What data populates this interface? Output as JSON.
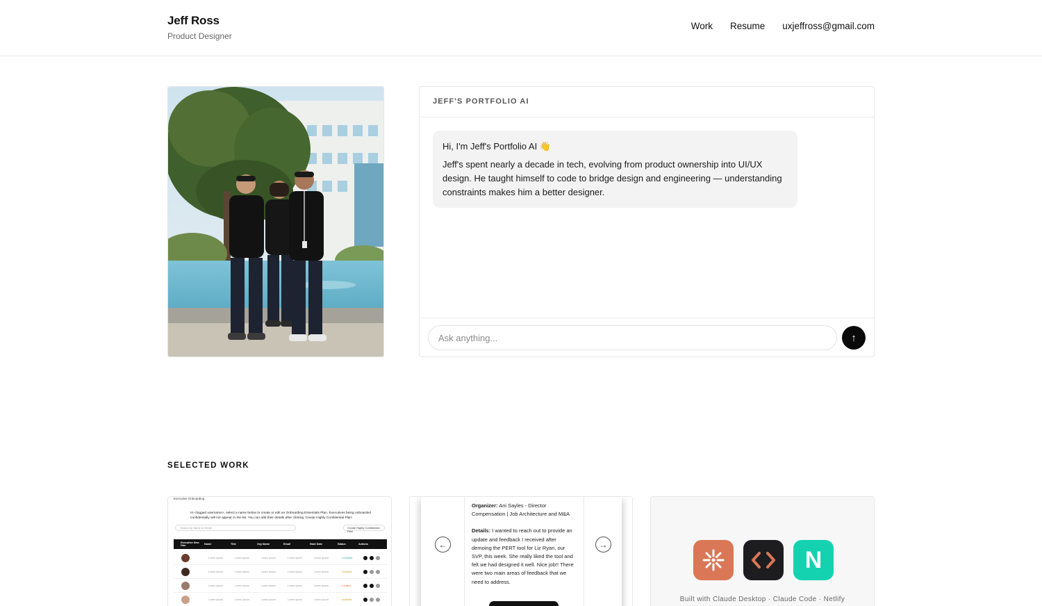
{
  "header": {
    "name": "Jeff Ross",
    "role": "Product Designer",
    "nav": [
      {
        "label": "Work"
      },
      {
        "label": "Resume"
      },
      {
        "label": "uxjeffross@gmail.com"
      }
    ]
  },
  "chat": {
    "title": "JEFF'S PORTFOLIO AI",
    "greeting": "Hi, I'm Jeff's Portfolio AI 👋",
    "message": "Jeff's spent nearly a decade in tech, evolving from product ownership into UI/UX design. He taught himself to code to bridge design and engineering — understanding constraints makes him a better designer.",
    "input_placeholder": "Ask anything...",
    "send_icon": "↑"
  },
  "work": {
    "section_title": "SELECTED WORK",
    "card1": {
      "breadcrumb": "Executive Onboarding",
      "note": "Hi <logged username>, select a name below to create or edit an Onboarding Essentials Plan. Executives being onboarded confidentially will not appear in the list. You can add their details after clicking 'Create Highly Confidential Plan'.",
      "search_placeholder": "Search by Name or Email",
      "plan_button": "Create Highly Confidential Plan",
      "columns": [
        "Executive New Hire",
        "Name",
        "Title",
        "Org Name",
        "Email",
        "Start Date",
        "Status",
        "Actions"
      ],
      "rows": [
        {
          "cells": [
            "Lorem Ipsum",
            "Lorem Ipsum",
            "Lorem Ipsum",
            "Lorem Ipsum",
            "Lorem Ipsum"
          ],
          "status": "Complete",
          "status_color": "#2bb3a3"
        },
        {
          "cells": [
            "Lorem Ipsum",
            "Lorem Ipsum",
            "Lorem Ipsum",
            "Lorem Ipsum",
            "Lorem Ipsum"
          ],
          "status": "Available",
          "status_color": "#e0a020"
        },
        {
          "cells": [
            "Lorem Ipsum",
            "Lorem Ipsum",
            "Lorem Ipsum",
            "Lorem Ipsum",
            "Lorem Ipsum"
          ],
          "status": "Created",
          "status_color": "#e07020"
        },
        {
          "cells": [
            "Lorem Ipsum",
            "Lorem Ipsum",
            "Lorem Ipsum",
            "Lorem Ipsum",
            "Lorem Ipsum"
          ],
          "status": "Available",
          "status_color": "#e0a020"
        }
      ]
    },
    "card2": {
      "organizer_label": "Organizer:",
      "organizer_value": "Ani Sayles - Director Compensation | Job Architecture and M&A",
      "details_label": "Details:",
      "details_value": "I wanted to reach out to provide an update and feedback I received after demoing the PERT tool for Liz Ryan, our SVP, this week. She really liked the tool and felt we had designed it well. Nice job!! There were two main areas of feedback that we need to address."
    },
    "card3": {
      "tools": [
        "claude-desktop-icon",
        "claude-code-icon",
        "netlify-icon"
      ],
      "netlify_letter": "N",
      "caption": "Built with Claude Desktop · Claude Code · Netlify"
    }
  },
  "colors": {
    "claude": "#d97757",
    "code": "#1d1d1f",
    "netlify": "#14d2b0"
  }
}
